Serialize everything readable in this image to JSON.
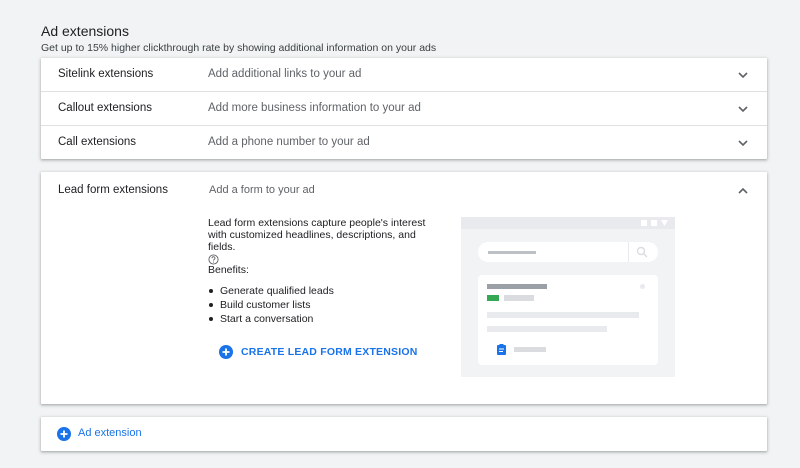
{
  "section": {
    "title": "Ad extensions",
    "subtitle": "Get up to 15% higher clickthrough rate by showing additional information on your ads"
  },
  "extensions": [
    {
      "name": "Sitelink extensions",
      "description": "Add additional links to your ad"
    },
    {
      "name": "Callout extensions",
      "description": "Add more business information to your ad"
    },
    {
      "name": "Call extensions",
      "description": "Add a phone number to your ad"
    }
  ],
  "lead_form": {
    "name": "Lead form extensions",
    "description": "Add a form to your ad",
    "body_line1": "Lead form extensions capture people's interest",
    "body_line2": "with customized headlines, descriptions, and fields.",
    "benefits_label": "Benefits:",
    "benefits": [
      "Generate qualified leads",
      "Build customer lists",
      "Start a conversation"
    ],
    "create_button": "CREATE LEAD FORM EXTENSION"
  },
  "add_extension": {
    "label": "Ad extension"
  },
  "colors": {
    "accent": "#1a73e8",
    "green_chip": "#34a853",
    "background": "#f1f3f4"
  },
  "icons": {
    "chevron_down": "chevron-down-icon",
    "chevron_up": "chevron-up-icon",
    "help": "help-circle-icon",
    "add": "add-circle-icon",
    "search": "search-icon",
    "form": "form-icon"
  }
}
